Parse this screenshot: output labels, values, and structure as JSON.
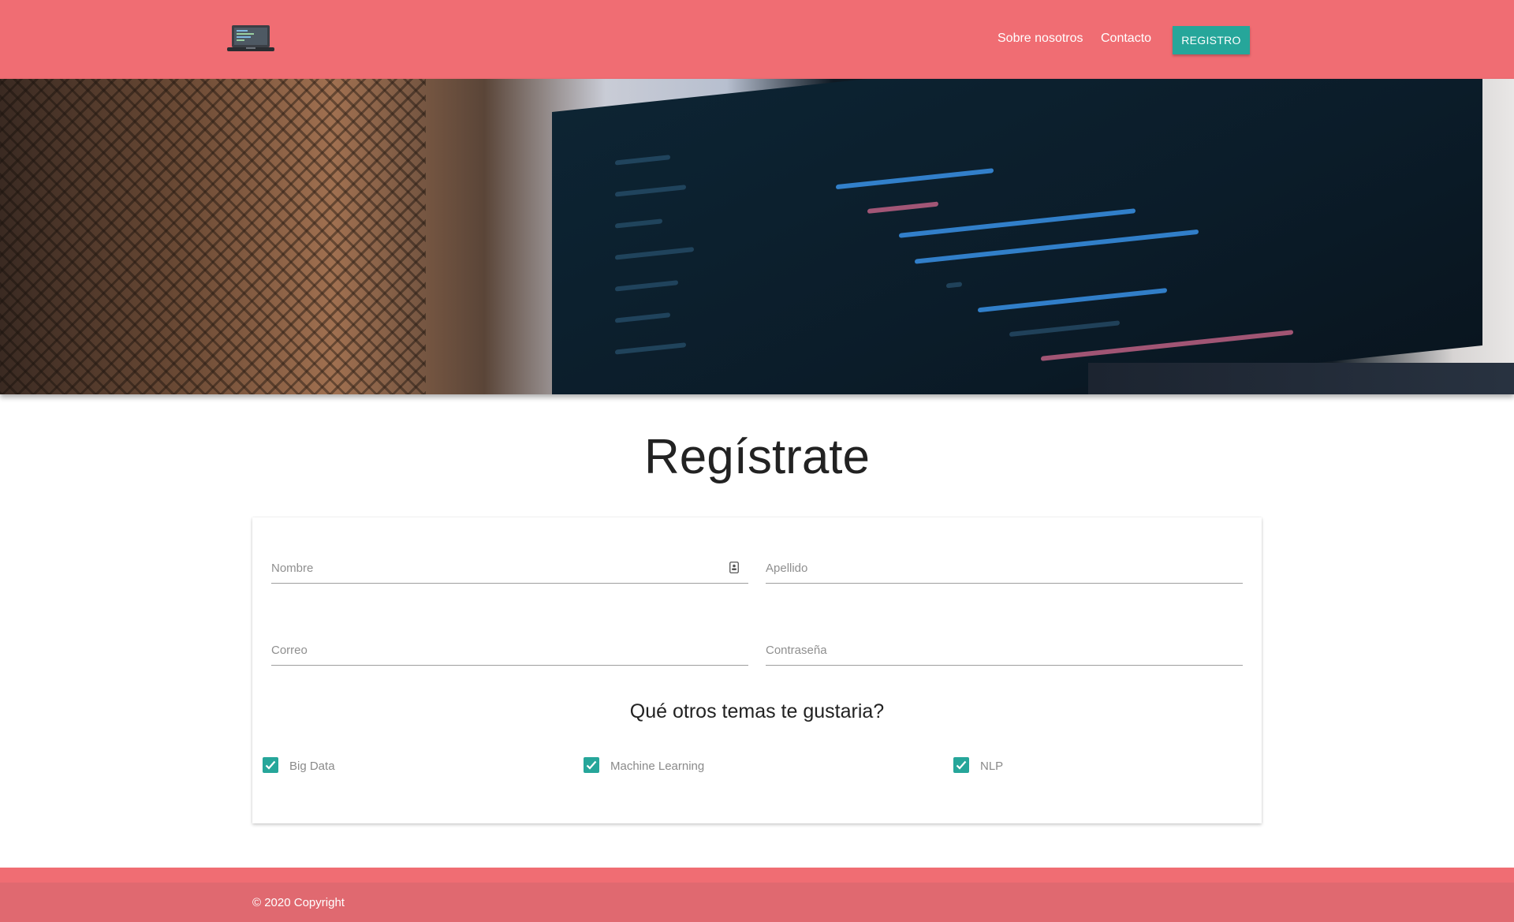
{
  "nav": {
    "logo_icon": "laptop-icon",
    "links": [
      "Sobre nosotros",
      "Contacto"
    ],
    "register_label": "REGISTRO"
  },
  "hero": {
    "image": "laptop-with-code-photo"
  },
  "page": {
    "title": "Regístrate"
  },
  "form": {
    "fields": {
      "nombre": "Nombre",
      "apellido": "Apellido",
      "correo": "Correo",
      "password": "Contraseña"
    },
    "topics_title": "Qué otros temas te gustaria?",
    "topics": [
      {
        "label": "Big Data",
        "checked": true
      },
      {
        "label": "Machine Learning",
        "checked": true
      },
      {
        "label": "NLP",
        "checked": true
      }
    ]
  },
  "footer": {
    "copyright": "© 2020 Copyright"
  },
  "colors": {
    "primary": "#f06d73",
    "accent": "#26a69a"
  }
}
